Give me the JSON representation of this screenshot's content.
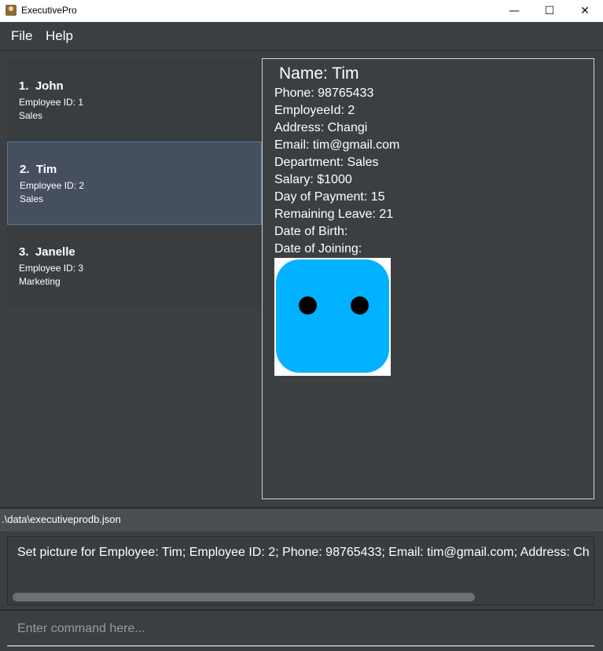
{
  "window": {
    "title": "ExecutivePro",
    "minimize": "—",
    "maximize": "☐",
    "close": "✕"
  },
  "menu": {
    "file": "File",
    "help": "Help"
  },
  "employees": [
    {
      "name": "1.  John",
      "id_text": "Employee ID: 1",
      "department": "Sales"
    },
    {
      "name": "2.  Tim",
      "id_text": "Employee ID: 2",
      "department": "Sales"
    },
    {
      "name": "3.  Janelle",
      "id_text": "Employee ID: 3",
      "department": "Marketing"
    }
  ],
  "detail": {
    "name": "Name: Tim",
    "phone": "Phone: 98765433",
    "employee_id": "EmployeeId: 2",
    "address": "Address: Changi",
    "email": "Email: tim@gmail.com",
    "department": "Department: Sales",
    "salary": "Salary: $1000",
    "day_of_payment": "Day of Payment: 15",
    "remaining_leave": "Remaining Leave: 21",
    "date_of_birth": "Date of Birth:",
    "date_of_joining": "Date of Joining:"
  },
  "status": {
    "file_path": ".\\data\\executiveprodb.json"
  },
  "result": {
    "text": "Set picture for Employee: Tim; Employee ID: 2; Phone: 98765433; Email: tim@gmail.com; Address: Ch"
  },
  "command": {
    "placeholder": "Enter command here..."
  },
  "colors": {
    "background": "#3c3f41",
    "selected_card": "#464f5f",
    "avatar_blue": "#00b2ff"
  }
}
